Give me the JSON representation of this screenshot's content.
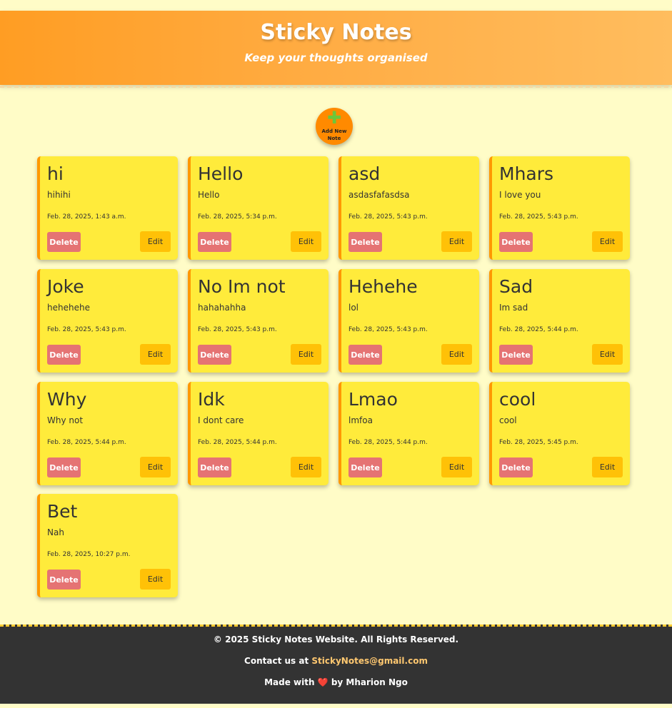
{
  "header": {
    "title": "Sticky Notes",
    "subtitle": "Keep your thoughts organised"
  },
  "add_note": {
    "icon": "plus-icon",
    "label": "Add New Note"
  },
  "notes": [
    {
      "title": "hi",
      "body": "hihihi",
      "date": "Feb. 28, 2025, 1:43 a.m.",
      "delete": "Delete",
      "edit": "Edit"
    },
    {
      "title": "Hello",
      "body": "Hello",
      "date": "Feb. 28, 2025, 5:34 p.m.",
      "delete": "Delete",
      "edit": "Edit"
    },
    {
      "title": "asd",
      "body": "asdasfafasdsa",
      "date": "Feb. 28, 2025, 5:43 p.m.",
      "delete": "Delete",
      "edit": "Edit"
    },
    {
      "title": "Mhars",
      "body": "I love you",
      "date": "Feb. 28, 2025, 5:43 p.m.",
      "delete": "Delete",
      "edit": "Edit"
    },
    {
      "title": "Joke",
      "body": "hehehehe",
      "date": "Feb. 28, 2025, 5:43 p.m.",
      "delete": "Delete",
      "edit": "Edit"
    },
    {
      "title": "No Im not",
      "body": "hahahahha",
      "date": "Feb. 28, 2025, 5:43 p.m.",
      "delete": "Delete",
      "edit": "Edit"
    },
    {
      "title": "Hehehe",
      "body": "lol",
      "date": "Feb. 28, 2025, 5:43 p.m.",
      "delete": "Delete",
      "edit": "Edit"
    },
    {
      "title": "Sad",
      "body": "Im sad",
      "date": "Feb. 28, 2025, 5:44 p.m.",
      "delete": "Delete",
      "edit": "Edit"
    },
    {
      "title": "Why",
      "body": "Why not",
      "date": "Feb. 28, 2025, 5:44 p.m.",
      "delete": "Delete",
      "edit": "Edit"
    },
    {
      "title": "Idk",
      "body": "I dont care",
      "date": "Feb. 28, 2025, 5:44 p.m.",
      "delete": "Delete",
      "edit": "Edit"
    },
    {
      "title": "Lmao",
      "body": "lmfoa",
      "date": "Feb. 28, 2025, 5:44 p.m.",
      "delete": "Delete",
      "edit": "Edit"
    },
    {
      "title": "cool",
      "body": "cool",
      "date": "Feb. 28, 2025, 5:45 p.m.",
      "delete": "Delete",
      "edit": "Edit"
    },
    {
      "title": "Bet",
      "body": "Nah",
      "date": "Feb. 28, 2025, 10:27 p.m.",
      "delete": "Delete",
      "edit": "Edit"
    }
  ],
  "footer": {
    "copyright": "© 2025 Sticky Notes Website. All Rights Reserved.",
    "contact_prefix": "Contact us at ",
    "contact_email": "StickyNotes@gmail.com",
    "made_prefix": "Made with ",
    "heart": "❤️",
    "made_suffix": " by Mharion Ngo"
  },
  "colors": {
    "page_background": "#fffcc7",
    "header_orange": "#ff9d23",
    "note_yellow": "#ffeb3b",
    "note_border": "#ff9800",
    "delete_button": "#e57373",
    "edit_button": "#ffc107",
    "footer_background": "#333333",
    "footer_link": "#ffc870"
  }
}
